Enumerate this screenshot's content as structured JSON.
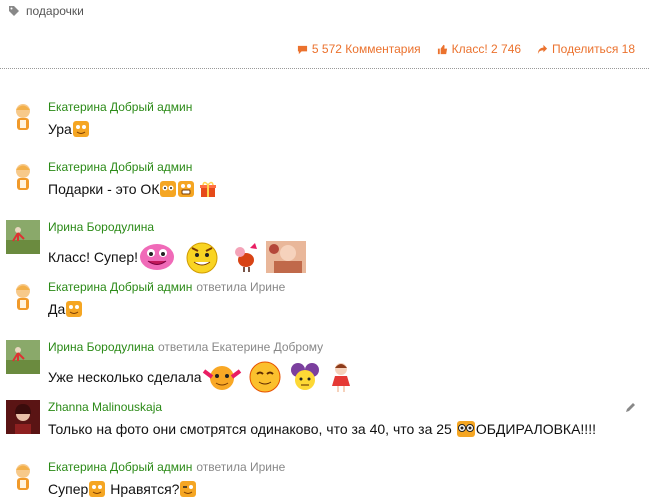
{
  "tag": {
    "label": "подарочки",
    "icon": "tag-icon"
  },
  "actions": {
    "comments": "5 572 Комментария",
    "likes": "Класс! 2 746",
    "share": "Поделиться 18",
    "color": "#eb722e"
  },
  "comments": [
    {
      "author": "Екатерина Добрый админ",
      "reply": "",
      "text": "Ура",
      "avatar": "doll-avatar"
    },
    {
      "author": "Екатерина Добрый админ",
      "reply": "",
      "text": "Подарки - это ОК",
      "avatar": "doll-avatar"
    },
    {
      "author": "Ирина Бородулина",
      "reply": "",
      "text": "Класс! Супер!",
      "avatar": "photo-avatar"
    },
    {
      "author": "Екатерина Добрый админ",
      "reply": "ответила Ирине",
      "text": "Да",
      "avatar": "doll-avatar"
    },
    {
      "author": "Ирина Бородулина",
      "reply": "ответила Екатерине Доброму",
      "text": "Уже несколько сделала",
      "avatar": "photo-avatar"
    },
    {
      "author": "Zhanna Malinouskaja",
      "reply": "",
      "text": "Только на фото они смотрятся одинаково, что за 40, что за 25",
      "text2": "ОБДИРАЛОВКА!!!!",
      "avatar": "portrait-avatar"
    },
    {
      "author": "Екатерина Добрый админ",
      "reply": "ответила Ирине",
      "text": "Супер",
      "text2": "Нравятся?",
      "avatar": "doll-avatar"
    }
  ]
}
